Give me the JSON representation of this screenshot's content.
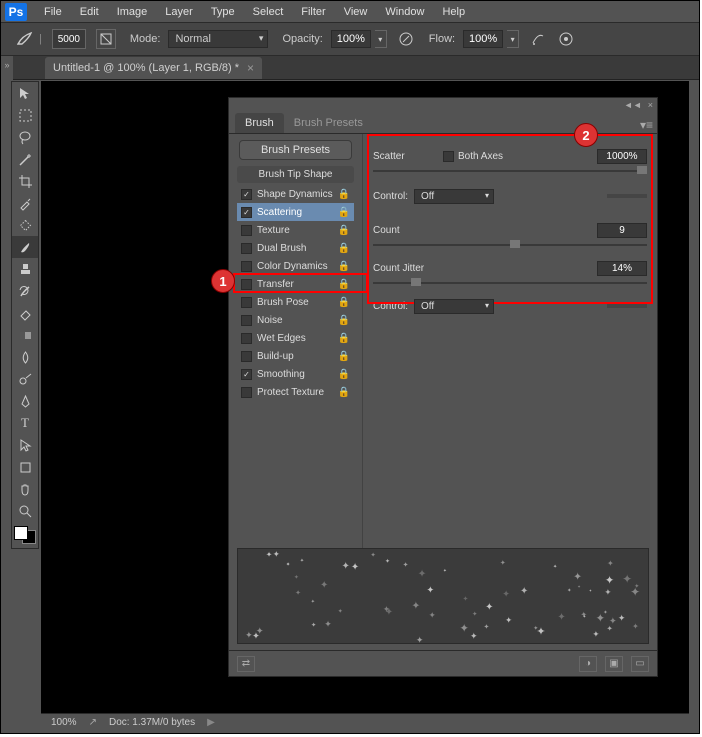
{
  "app": {
    "logo": "Ps"
  },
  "menu": [
    "File",
    "Edit",
    "Image",
    "Layer",
    "Type",
    "Select",
    "Filter",
    "View",
    "Window",
    "Help"
  ],
  "options": {
    "brush_size": "5000",
    "mode_label": "Mode:",
    "mode_value": "Normal",
    "opacity_label": "Opacity:",
    "opacity_value": "100%",
    "flow_label": "Flow:",
    "flow_value": "100%"
  },
  "document": {
    "tab_title": "Untitled-1 @ 100% (Layer 1, RGB/8) *"
  },
  "brush_panel": {
    "tabs": [
      "Brush",
      "Brush Presets"
    ],
    "presets_button": "Brush Presets",
    "tip_header": "Brush Tip Shape",
    "rows": [
      {
        "label": "Shape Dynamics",
        "checked": true,
        "selected": false
      },
      {
        "label": "Scattering",
        "checked": true,
        "selected": true
      },
      {
        "label": "Texture",
        "checked": false,
        "selected": false
      },
      {
        "label": "Dual Brush",
        "checked": false,
        "selected": false
      },
      {
        "label": "Color Dynamics",
        "checked": false,
        "selected": false
      },
      {
        "label": "Transfer",
        "checked": false,
        "selected": false
      },
      {
        "label": "Brush Pose",
        "checked": false,
        "selected": false
      },
      {
        "label": "Noise",
        "checked": false,
        "selected": false
      },
      {
        "label": "Wet Edges",
        "checked": false,
        "selected": false
      },
      {
        "label": "Build-up",
        "checked": false,
        "selected": false
      },
      {
        "label": "Smoothing",
        "checked": true,
        "selected": false
      },
      {
        "label": "Protect Texture",
        "checked": false,
        "selected": false
      }
    ],
    "scatter": {
      "label": "Scatter",
      "both_axes_label": "Both Axes",
      "both_axes_checked": false,
      "value": "1000%"
    },
    "control1": {
      "label": "Control:",
      "value": "Off"
    },
    "count": {
      "label": "Count",
      "value": "9"
    },
    "count_jitter": {
      "label": "Count Jitter",
      "value": "14%"
    },
    "control2": {
      "label": "Control:",
      "value": "Off"
    }
  },
  "callouts": {
    "one": "1",
    "two": "2"
  },
  "status": {
    "zoom": "100%",
    "doc_info": "Doc: 1.37M/0 bytes"
  }
}
